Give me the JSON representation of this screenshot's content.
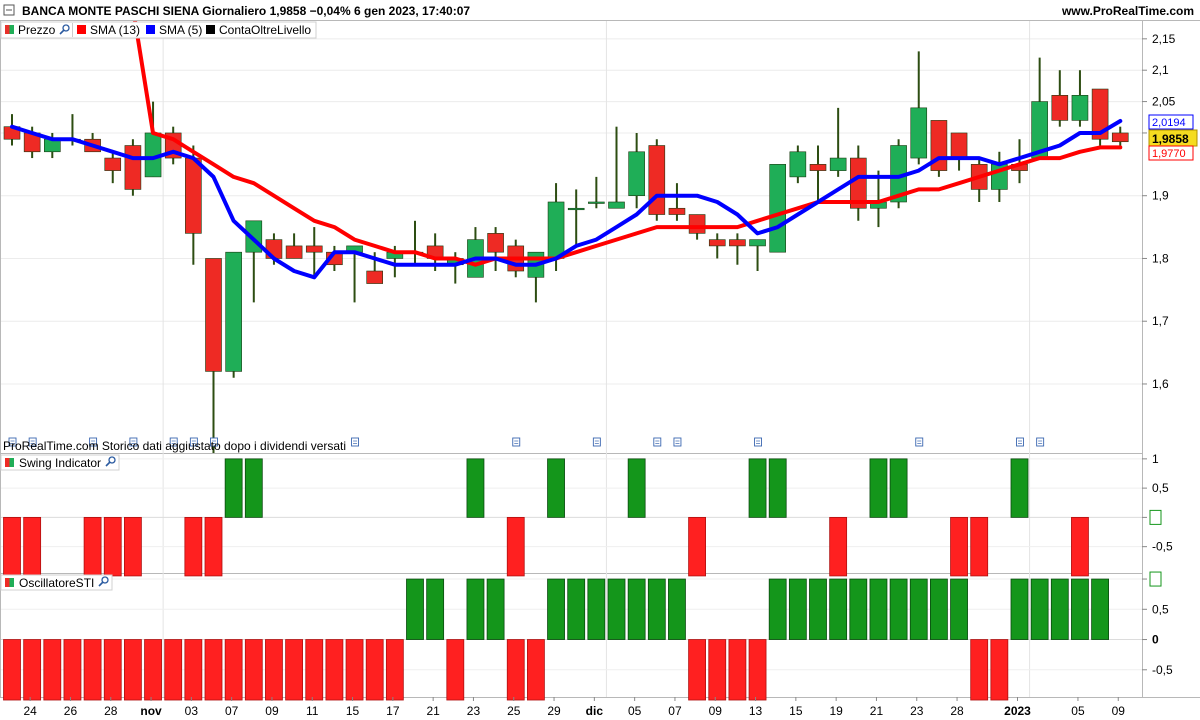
{
  "header": {
    "title": "BANCA MONTE PASCHI SIENA Giornaliero 1,9858 −0,04% 6 gen 2023, 17:40:07",
    "site": "www.ProRealTime.com"
  },
  "legend": {
    "items": [
      {
        "label": "Prezzo",
        "color": "#e8302a",
        "icon": "wrench-icon"
      },
      {
        "label": "SMA (13)",
        "color": "#ff0000"
      },
      {
        "label": "SMA (5)",
        "color": "#0000ff"
      },
      {
        "label": "ContaOltreLivello",
        "color": "#000000"
      }
    ]
  },
  "footnote": "ProRealTime.com  Storico dati aggiustato dopo i dividendi versati",
  "price_badges": {
    "sma5": "2,0194",
    "last": "1,9858",
    "sma13": "1,9770"
  },
  "colors": {
    "up": "#1fae57",
    "down": "#ee2a24",
    "wick": "#2d4d12",
    "sma13": "#ff0000",
    "sma5": "#0000ff",
    "ind_up": "#14961b",
    "ind_down": "#ff2020"
  },
  "chart_data": [
    {
      "type": "candlestick",
      "title": "BANCA MONTE PASCHI SIENA Giornaliero",
      "ylim": [
        1.49,
        2.18
      ],
      "y_ticks": [
        1.6,
        1.7,
        1.8,
        1.9,
        2.0,
        2.05,
        2.1,
        2.15
      ],
      "y_tick_labels": [
        "1,6",
        "1,7",
        "1,8",
        "1,9",
        "",
        "2,05",
        "2,1",
        "2,15"
      ],
      "x_tick_labels": [
        "24",
        "26",
        "28",
        "nov",
        "03",
        "07",
        "09",
        "11",
        "15",
        "17",
        "21",
        "23",
        "25",
        "29",
        "dic",
        "05",
        "07",
        "09",
        "13",
        "15",
        "19",
        "21",
        "23",
        "28",
        "2023",
        "05",
        "09"
      ],
      "candles": [
        {
          "o": 2.01,
          "h": 2.03,
          "l": 1.98,
          "c": 1.99
        },
        {
          "o": 2.0,
          "h": 2.01,
          "l": 1.96,
          "c": 1.97
        },
        {
          "o": 1.97,
          "h": 2.0,
          "l": 1.96,
          "c": 1.99
        },
        {
          "o": 1.99,
          "h": 2.03,
          "l": 1.98,
          "c": 1.99
        },
        {
          "o": 1.99,
          "h": 2.0,
          "l": 1.97,
          "c": 1.97
        },
        {
          "o": 1.96,
          "h": 1.97,
          "l": 1.92,
          "c": 1.94
        },
        {
          "o": 1.98,
          "h": 1.99,
          "l": 1.9,
          "c": 1.91
        },
        {
          "o": 1.93,
          "h": 2.05,
          "l": 1.93,
          "c": 2.0
        },
        {
          "o": 2.0,
          "h": 2.01,
          "l": 1.95,
          "c": 1.96
        },
        {
          "o": 1.96,
          "h": 1.98,
          "l": 1.79,
          "c": 1.84
        },
        {
          "o": 1.8,
          "h": 1.8,
          "l": 1.49,
          "c": 1.62
        },
        {
          "o": 1.62,
          "h": 1.81,
          "l": 1.61,
          "c": 1.81
        },
        {
          "o": 1.81,
          "h": 1.85,
          "l": 1.73,
          "c": 1.86
        },
        {
          "o": 1.83,
          "h": 1.84,
          "l": 1.79,
          "c": 1.8
        },
        {
          "o": 1.82,
          "h": 1.84,
          "l": 1.8,
          "c": 1.8
        },
        {
          "o": 1.82,
          "h": 1.85,
          "l": 1.77,
          "c": 1.81
        },
        {
          "o": 1.81,
          "h": 1.82,
          "l": 1.78,
          "c": 1.79
        },
        {
          "o": 1.81,
          "h": 1.82,
          "l": 1.73,
          "c": 1.82
        },
        {
          "o": 1.78,
          "h": 1.81,
          "l": 1.76,
          "c": 1.76
        },
        {
          "o": 1.8,
          "h": 1.82,
          "l": 1.77,
          "c": 1.81
        },
        {
          "o": 1.81,
          "h": 1.86,
          "l": 1.79,
          "c": 1.81
        },
        {
          "o": 1.82,
          "h": 1.84,
          "l": 1.78,
          "c": 1.8
        },
        {
          "o": 1.79,
          "h": 1.81,
          "l": 1.76,
          "c": 1.8
        },
        {
          "o": 1.77,
          "h": 1.85,
          "l": 1.77,
          "c": 1.83
        },
        {
          "o": 1.84,
          "h": 1.85,
          "l": 1.78,
          "c": 1.81
        },
        {
          "o": 1.82,
          "h": 1.83,
          "l": 1.77,
          "c": 1.78
        },
        {
          "o": 1.77,
          "h": 1.81,
          "l": 1.73,
          "c": 1.81
        },
        {
          "o": 1.8,
          "h": 1.92,
          "l": 1.78,
          "c": 1.89
        },
        {
          "o": 1.88,
          "h": 1.91,
          "l": 1.82,
          "c": 1.88
        },
        {
          "o": 1.89,
          "h": 1.93,
          "l": 1.88,
          "c": 1.89
        },
        {
          "o": 1.88,
          "h": 2.01,
          "l": 1.88,
          "c": 1.89
        },
        {
          "o": 1.9,
          "h": 2.0,
          "l": 1.88,
          "c": 1.97
        },
        {
          "o": 1.98,
          "h": 1.99,
          "l": 1.86,
          "c": 1.87
        },
        {
          "o": 1.88,
          "h": 1.92,
          "l": 1.86,
          "c": 1.87
        },
        {
          "o": 1.87,
          "h": 1.87,
          "l": 1.83,
          "c": 1.84
        },
        {
          "o": 1.83,
          "h": 1.84,
          "l": 1.8,
          "c": 1.82
        },
        {
          "o": 1.83,
          "h": 1.84,
          "l": 1.79,
          "c": 1.82
        },
        {
          "o": 1.82,
          "h": 1.83,
          "l": 1.78,
          "c": 1.83
        },
        {
          "o": 1.81,
          "h": 1.95,
          "l": 1.81,
          "c": 1.95
        },
        {
          "o": 1.93,
          "h": 1.98,
          "l": 1.92,
          "c": 1.97
        },
        {
          "o": 1.95,
          "h": 1.98,
          "l": 1.89,
          "c": 1.94
        },
        {
          "o": 1.94,
          "h": 2.04,
          "l": 1.93,
          "c": 1.96
        },
        {
          "o": 1.96,
          "h": 1.98,
          "l": 1.86,
          "c": 1.88
        },
        {
          "o": 1.88,
          "h": 1.94,
          "l": 1.85,
          "c": 1.89
        },
        {
          "o": 1.89,
          "h": 1.99,
          "l": 1.88,
          "c": 1.98
        },
        {
          "o": 1.96,
          "h": 2.13,
          "l": 1.95,
          "c": 2.04
        },
        {
          "o": 2.02,
          "h": 2.02,
          "l": 1.93,
          "c": 1.94
        },
        {
          "o": 2.0,
          "h": 2.0,
          "l": 1.94,
          "c": 1.96
        },
        {
          "o": 1.95,
          "h": 1.96,
          "l": 1.89,
          "c": 1.91
        },
        {
          "o": 1.91,
          "h": 1.97,
          "l": 1.89,
          "c": 1.95
        },
        {
          "o": 1.95,
          "h": 1.99,
          "l": 1.92,
          "c": 1.94
        },
        {
          "o": 1.96,
          "h": 2.12,
          "l": 1.96,
          "c": 2.05
        },
        {
          "o": 2.06,
          "h": 2.1,
          "l": 2.01,
          "c": 2.02
        },
        {
          "o": 2.02,
          "h": 2.1,
          "l": 2.01,
          "c": 2.06
        },
        {
          "o": 2.07,
          "h": 2.07,
          "l": 1.98,
          "c": 1.99
        },
        {
          "o": 2.0,
          "h": 2.01,
          "l": 1.98,
          "c": 1.986
        }
      ],
      "series": [
        {
          "name": "SMA (13)",
          "values": [
            null,
            null,
            null,
            null,
            null,
            null,
            2.2,
            2.0,
            1.99,
            1.97,
            1.95,
            1.93,
            1.92,
            1.9,
            1.88,
            1.86,
            1.85,
            1.83,
            1.82,
            1.81,
            1.81,
            1.8,
            1.8,
            1.79,
            1.8,
            1.8,
            1.8,
            1.8,
            1.81,
            1.82,
            1.83,
            1.84,
            1.85,
            1.85,
            1.85,
            1.85,
            1.85,
            1.86,
            1.87,
            1.88,
            1.89,
            1.89,
            1.89,
            1.89,
            1.9,
            1.91,
            1.91,
            1.92,
            1.93,
            1.94,
            1.95,
            1.96,
            1.96,
            1.97,
            1.977,
            1.977
          ]
        },
        {
          "name": "SMA (5)",
          "values": [
            2.01,
            2.0,
            1.99,
            1.99,
            1.98,
            1.97,
            1.96,
            1.96,
            1.97,
            1.96,
            1.93,
            1.86,
            1.83,
            1.8,
            1.78,
            1.77,
            1.81,
            1.81,
            1.8,
            1.79,
            1.79,
            1.79,
            1.79,
            1.8,
            1.8,
            1.79,
            1.79,
            1.8,
            1.82,
            1.83,
            1.85,
            1.87,
            1.9,
            1.9,
            1.9,
            1.89,
            1.87,
            1.84,
            1.85,
            1.87,
            1.89,
            1.91,
            1.93,
            1.93,
            1.93,
            1.94,
            1.96,
            1.96,
            1.96,
            1.95,
            1.96,
            1.97,
            1.98,
            2.0,
            2.0,
            2.019
          ]
        }
      ]
    },
    {
      "type": "bar",
      "title": "Swing Indicator",
      "ylim": [
        -0.95,
        1.1
      ],
      "y_tick_labels": [
        "1",
        "0,5",
        "0",
        "-0,5"
      ],
      "values": [
        -1,
        -1,
        0,
        0,
        -1,
        -1,
        -1,
        0,
        0,
        -1,
        -1,
        1,
        1,
        0,
        0,
        0,
        0,
        0,
        0,
        0,
        0,
        0,
        0,
        1,
        0,
        -1,
        0,
        1,
        0,
        0,
        0,
        1,
        0,
        0,
        -1,
        0,
        0,
        1,
        1,
        0,
        0,
        -1,
        0,
        1,
        1,
        0,
        0,
        -1,
        -1,
        0,
        1,
        0,
        0,
        -1,
        0,
        0
      ]
    },
    {
      "type": "bar",
      "title": "OscillatoreSTI",
      "ylim": [
        -0.95,
        1.1
      ],
      "y_tick_labels": [
        "1",
        "0,5",
        "0",
        "-0,5"
      ],
      "values": [
        -1,
        -1,
        -1,
        -1,
        -1,
        -1,
        -1,
        -1,
        -1,
        -1,
        -1,
        -1,
        -1,
        -1,
        -1,
        -1,
        -1,
        -1,
        -1,
        -1,
        1,
        1,
        -1,
        1,
        1,
        -1,
        -1,
        1,
        1,
        1,
        1,
        1,
        1,
        1,
        -1,
        -1,
        -1,
        -1,
        1,
        1,
        1,
        1,
        1,
        1,
        1,
        1,
        1,
        1,
        -1,
        -1,
        1,
        1,
        1,
        1,
        1,
        0
      ]
    }
  ]
}
